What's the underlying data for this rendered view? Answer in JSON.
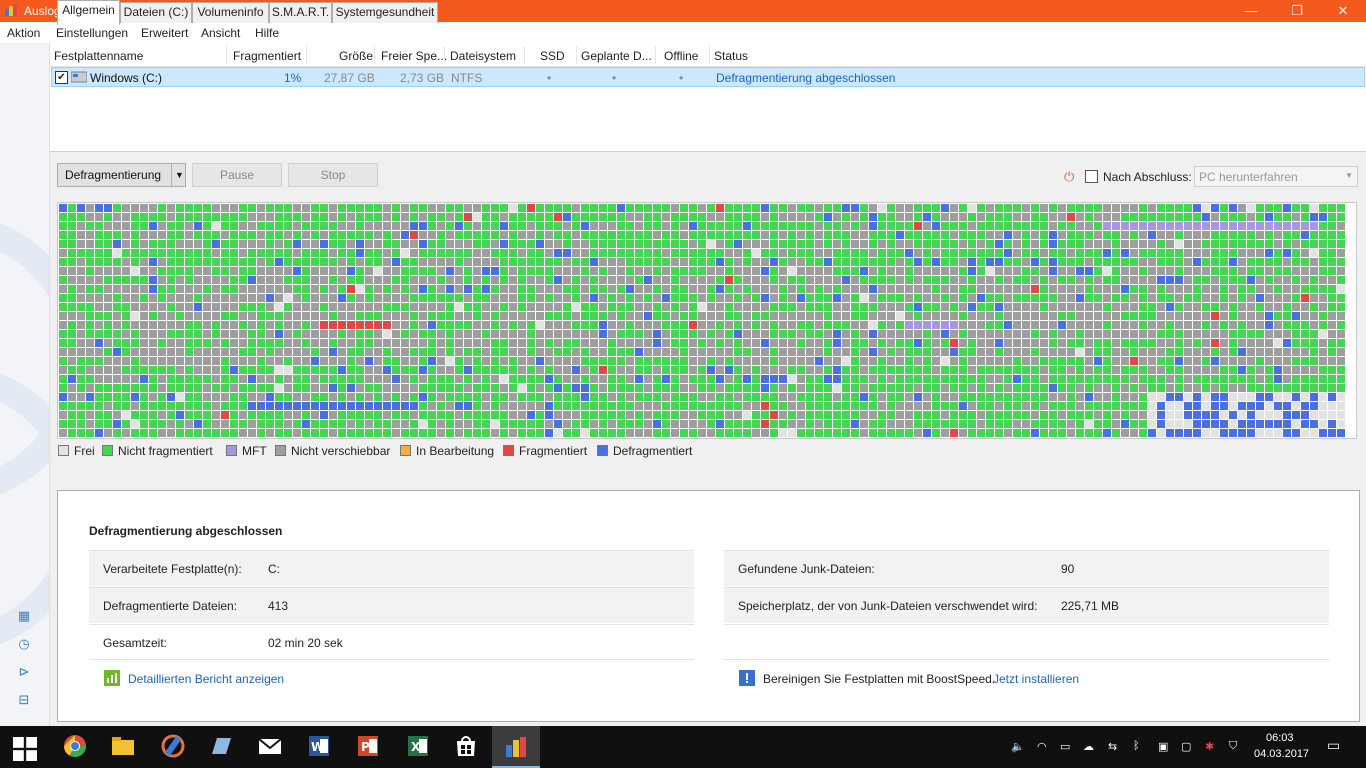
{
  "window": {
    "title": "Auslogics Disk Defrag",
    "minimize": "—",
    "maximize": "❐",
    "close": "✕"
  },
  "menu": [
    "Aktion",
    "Einstellungen",
    "Erweitert",
    "Ansicht",
    "Hilfe"
  ],
  "disk_list": {
    "columns": [
      "Festplattenname",
      "Fragmentiert",
      "Größe",
      "Freier Spe...",
      "Dateisystem",
      "SSD",
      "Geplante D...",
      "Offline",
      "Status"
    ],
    "rows": [
      {
        "checked": true,
        "name": "Windows (C:)",
        "fragmented": "1%",
        "size": "27,87 GB",
        "free": "2,73 GB",
        "filesystem": "NTFS",
        "ssd": "•",
        "scheduled": "•",
        "offline": "•",
        "status": "Defragmentierung abgeschlossen"
      }
    ]
  },
  "toolbar": {
    "defrag_label": "Defragmentierung",
    "pause_label": "Pause",
    "stop_label": "Stop",
    "after_label": "Nach Abschluss:",
    "after_value": "PC herunterfahren"
  },
  "legend": {
    "free": "Frei",
    "not_fragmented": "Nicht fragmentiert",
    "mft": "MFT",
    "immovable": "Nicht verschiebbar",
    "in_progress": "In Bearbeitung",
    "fragmented": "Fragmentiert",
    "defragmented": "Defragmentiert",
    "colors": {
      "free": "#e2e2e2",
      "not_fragmented": "#44d552",
      "mft": "#a796e2",
      "immovable": "#9e9e9e",
      "in_progress": "#f5b041",
      "fragmented": "#e04848",
      "defragmented": "#4a6fe0"
    }
  },
  "tabs": [
    "Allgemein",
    "Dateien (C:)",
    "Volumeninfo",
    "S.M.A.R.T.",
    "Systemgesundheit"
  ],
  "info": {
    "title": "Defragmentierung abgeschlossen",
    "left": [
      {
        "k": "Verarbeitete Festplatte(n):",
        "v": "C:"
      },
      {
        "k": "Defragmentierte Dateien:",
        "v": "413"
      },
      {
        "k": "Gesamtzeit:",
        "v": "02 min 20 sek"
      }
    ],
    "right": [
      {
        "k": "Gefundene Junk-Dateien:",
        "v": "90"
      },
      {
        "k": "Speicherplatz, der von Junk-Dateien verschwendet wird:",
        "v": "225,71 MB"
      }
    ],
    "report_link": "Detaillierten Bericht anzeigen",
    "boost_text": "Bereinigen Sie Festplatten mit BoostSpeed.",
    "install_link": "Jetzt installieren"
  },
  "taskbar": {
    "time": "06:03",
    "date": "04.03.2017"
  }
}
